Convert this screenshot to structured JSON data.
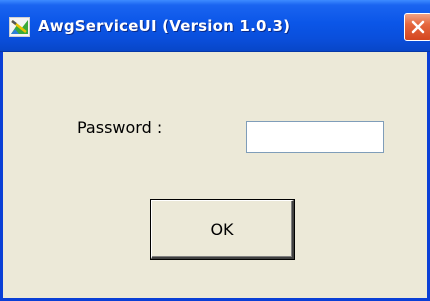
{
  "window": {
    "title": "AwgServiceUI (Version 1.0.3)",
    "icon": "app-icon",
    "close_icon": "close-icon",
    "colors": {
      "titlebar": "#0b56e8",
      "close": "#e5673e",
      "client": "#ece9d8"
    }
  },
  "form": {
    "password_label": "Password :",
    "password_value": "",
    "ok_label": "OK"
  }
}
